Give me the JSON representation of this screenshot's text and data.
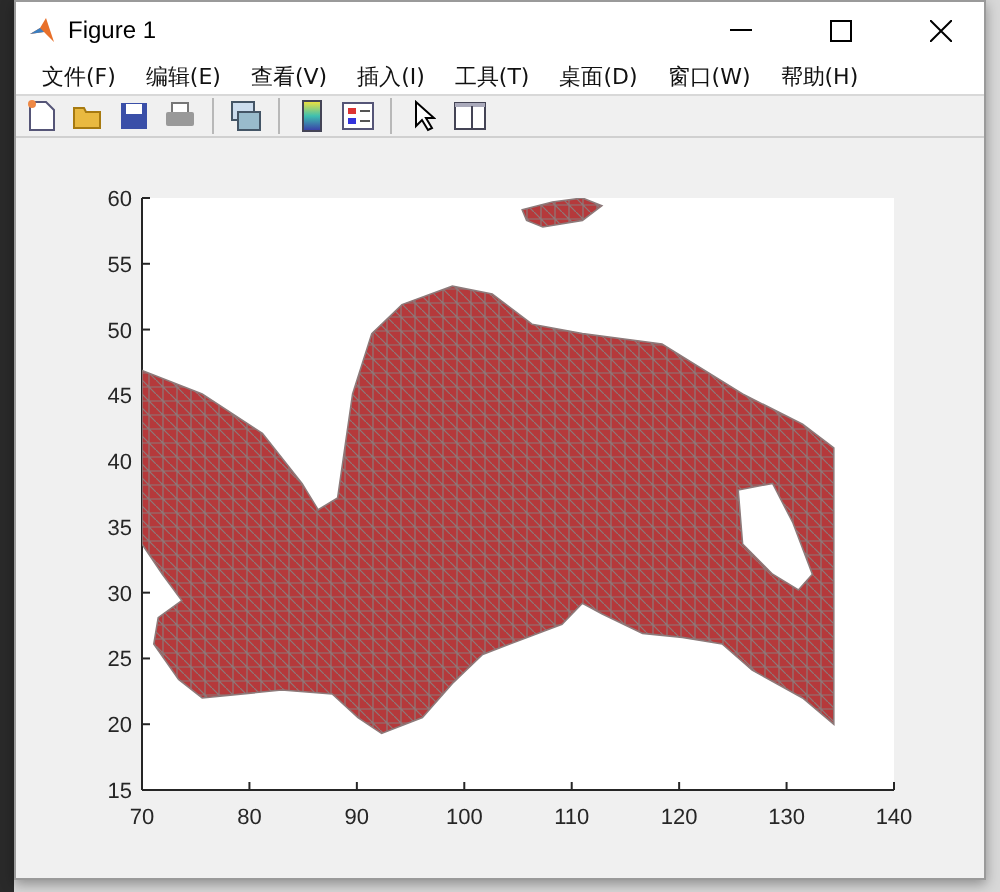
{
  "window": {
    "title": "Figure 1"
  },
  "menu": [
    {
      "label": "文件(F)"
    },
    {
      "label": "编辑(E)"
    },
    {
      "label": "查看(V)"
    },
    {
      "label": "插入(I)"
    },
    {
      "label": "工具(T)"
    },
    {
      "label": "桌面(D)"
    },
    {
      "label": "窗口(W)"
    },
    {
      "label": "帮助(H)"
    }
  ],
  "toolbar": [
    {
      "kind": "new"
    },
    {
      "kind": "open"
    },
    {
      "kind": "save"
    },
    {
      "kind": "print"
    },
    {
      "kind": "separator"
    },
    {
      "kind": "link"
    },
    {
      "kind": "separator"
    },
    {
      "kind": "colorbar"
    },
    {
      "kind": "legend"
    },
    {
      "kind": "separator"
    },
    {
      "kind": "pointer"
    },
    {
      "kind": "panel"
    }
  ],
  "chart_data": {
    "type": "area",
    "xlim": [
      70,
      140
    ],
    "ylim": [
      15,
      60
    ],
    "xticks": [
      70,
      80,
      90,
      100,
      110,
      120,
      130,
      140
    ],
    "yticks": [
      15,
      20,
      25,
      30,
      35,
      40,
      45,
      50,
      55,
      60
    ]
  }
}
